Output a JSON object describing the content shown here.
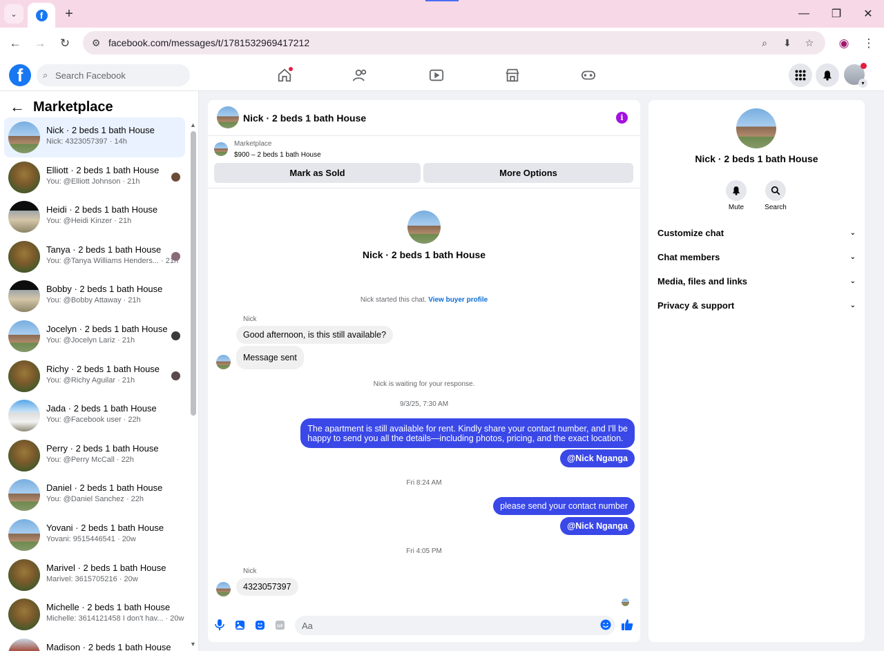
{
  "browser": {
    "url": "facebook.com/messages/t/1781532969417212"
  },
  "fb": {
    "search_placeholder": "Search Facebook"
  },
  "sidebar": {
    "title": "Marketplace",
    "conversations": [
      {
        "name": "Nick · 2 beds 1 bath House",
        "sub": "Nick: 4323057397 · 14h"
      },
      {
        "name": "Elliott · 2 beds 1 bath House",
        "sub": "You: @Elliott Johnson · 21h"
      },
      {
        "name": "Heidi · 2 beds 1 bath House",
        "sub": "You: @Heidi Kinzer · 21h"
      },
      {
        "name": "Tanya · 2 beds 1 bath House",
        "sub": "You: @Tanya Williams Henders... · 21h"
      },
      {
        "name": "Bobby · 2 beds 1 bath House",
        "sub": "You: @Bobby Attaway · 21h"
      },
      {
        "name": "Jocelyn · 2 beds 1 bath House",
        "sub": "You: @Jocelyn Lariz · 21h"
      },
      {
        "name": "Richy · 2 beds 1 bath House",
        "sub": "You: @Richy Aguilar · 21h"
      },
      {
        "name": "Jada · 2 beds 1 bath House",
        "sub": "You: @Facebook user · 22h"
      },
      {
        "name": "Perry · 2 beds 1 bath House",
        "sub": "You: @Perry McCall · 22h"
      },
      {
        "name": "Daniel · 2 beds 1 bath House",
        "sub": "You: @Daniel Sanchez · 22h"
      },
      {
        "name": "Yovani · 2 beds 1 bath House",
        "sub": "Yovani: 9515446541 · 20w"
      },
      {
        "name": "Marivel · 2 beds 1 bath House",
        "sub": "Marivel: 3615705216 · 20w"
      },
      {
        "name": "Michelle · 2 beds 1 bath House",
        "sub": "Michelle: 3614121458 I don't hav... · 20w"
      },
      {
        "name": "Madison · 2 beds 1 bath House",
        "sub": ""
      }
    ]
  },
  "chat": {
    "title": "Nick · 2 beds 1 bath House",
    "listing_source": "Marketplace",
    "listing_price": "$900 – 2 beds 1 bath House",
    "mark_sold": "Mark as Sold",
    "more_options": "More Options",
    "center_name": "Nick · 2 beds 1 bath House",
    "started_text": "Nick started this chat.",
    "view_profile": "View buyer profile",
    "sender1": "Nick",
    "msg1": "Good afternoon, is this still available?",
    "msg2": "Message sent",
    "waiting": "Nick is waiting for your response.",
    "ts1": "9/3/25, 7:30 AM",
    "out1_line1": "The apartment is still available for rent. Kindly share your contact number, and I'll be",
    "out1_line2": "happy to send you all the details—including photos, pricing, and the exact location.",
    "mention": "@Nick Nganga",
    "ts2": "Fri 8:24 AM",
    "out2": "please send your contact number",
    "ts3": "Fri 4:05 PM",
    "sender2": "Nick",
    "msg3": "4323057397",
    "composer_placeholder": "Aa"
  },
  "rpanel": {
    "name": "Nick · 2 beds 1 bath House",
    "mute": "Mute",
    "search": "Search",
    "sections": [
      "Customize chat",
      "Chat members",
      "Media, files and links",
      "Privacy & support"
    ]
  }
}
